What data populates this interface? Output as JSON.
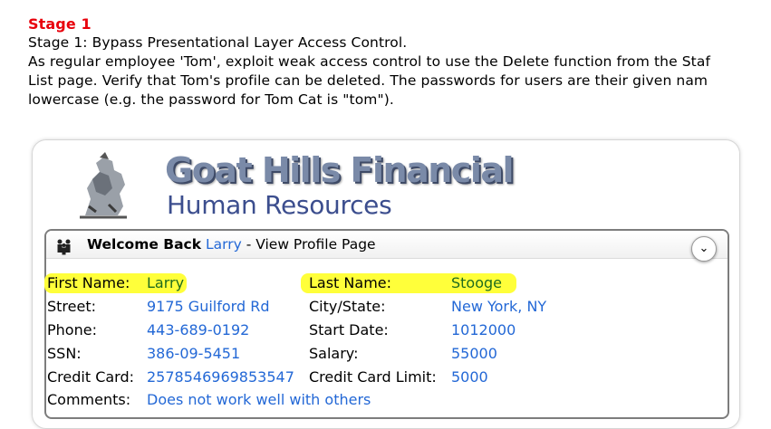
{
  "lesson": {
    "stage_title": "Stage 1",
    "line1": "Stage 1: Bypass Presentational Layer Access Control.",
    "line2": "As regular employee 'Tom', exploit weak access control to use the Delete function from the Staf",
    "line3": "List page. Verify that Tom's profile can be deleted. The passwords for users are their given nam",
    "line4": "lowercase (e.g. the password for Tom Cat is \"tom\")."
  },
  "app": {
    "brand_title": "Goat Hills Financial",
    "brand_subtitle": "Human Resources"
  },
  "panel": {
    "welcome_bold": "Welcome Back",
    "user": "Larry",
    "suffix": " - View Profile Page",
    "collapse_icon": "⌄"
  },
  "profile": {
    "first_name_label": "First Name:",
    "first_name": "Larry",
    "last_name_label": "Last Name:",
    "last_name": "Stooge",
    "street_label": "Street:",
    "street": "9175 Guilford Rd",
    "city_label": "City/State:",
    "city": "New York, NY",
    "phone_label": "Phone:",
    "phone": "443-689-0192",
    "start_label": "Start Date:",
    "start": "1012000",
    "ssn_label": "SSN:",
    "ssn": "386-09-5451",
    "salary_label": "Salary:",
    "salary": "55000",
    "cc_label": "Credit Card:",
    "cc": "2578546969853547",
    "cc_limit_label": "Credit Card Limit:",
    "cc_limit": "5000",
    "comments_label": "Comments:",
    "comments": "Does not work well with others"
  },
  "colors": {
    "stage_red": "#e8000b",
    "link_blue": "#2368d6",
    "highlight": "#ffff3a"
  }
}
